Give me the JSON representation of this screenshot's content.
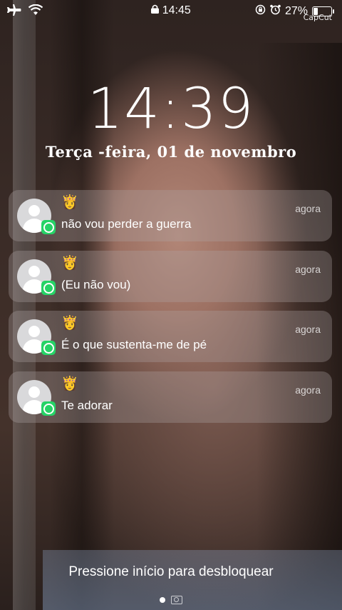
{
  "status_bar": {
    "airplane_icon": "airplane-icon",
    "wifi_icon": "wifi-icon",
    "lock_icon": "lock-icon",
    "time": "14:45",
    "rotation_lock_icon": "rotation-lock-icon",
    "alarm_icon": "alarm-icon",
    "battery_percent": "27%",
    "battery_level": 0.27,
    "watermark": "CapCut"
  },
  "lockscreen": {
    "clock": "14:39",
    "date": "Terça -feira, 01 de novembro",
    "unlock_hint": "Pressione início para desbloquear"
  },
  "notifications": [
    {
      "app": "WhatsApp",
      "emoji": "👸",
      "time": "agora",
      "message": "não vou perder a guerra"
    },
    {
      "app": "WhatsApp",
      "emoji": "👸",
      "time": "agora",
      "message": "(Eu não vou)"
    },
    {
      "app": "WhatsApp",
      "emoji": "👸",
      "time": "agora",
      "message": "É o que sustenta-me de pé"
    },
    {
      "app": "WhatsApp",
      "emoji": "👸",
      "time": "agora",
      "message": "Te adorar"
    }
  ],
  "colors": {
    "whatsapp_green": "#25d366",
    "notification_bg": "rgba(175,165,165,0.32)"
  }
}
